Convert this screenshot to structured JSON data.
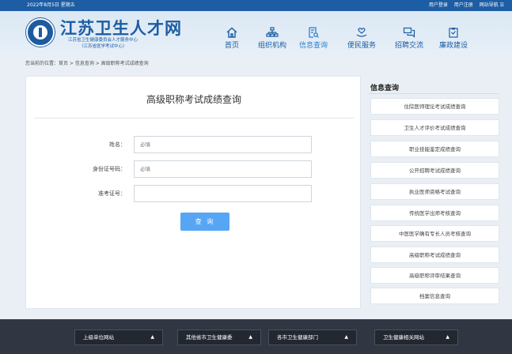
{
  "topbar": {
    "date": "2022年8月5日 星期五",
    "login": "用户登录",
    "register": "用户注册",
    "sitemap": "网站导航 ☰"
  },
  "header": {
    "title": "江苏卫生人才网",
    "subtitle1": "江苏省卫生健康委员会人才服务中心",
    "subtitle2": "（江苏省医学考试中心）",
    "brand_color": "#1c5da4",
    "nav": [
      {
        "label": "首页",
        "icon": "home-icon"
      },
      {
        "label": "组织机构",
        "icon": "org-chart-icon"
      },
      {
        "label": "信息查询",
        "icon": "search-document-icon"
      },
      {
        "label": "便民服务",
        "icon": "heart-hand-icon"
      },
      {
        "label": "招聘交流",
        "icon": "chat-icon"
      },
      {
        "label": "廉政建设",
        "icon": "clipboard-icon"
      }
    ]
  },
  "breadcrumb": "您当前的位置：首页 > 信息查询 > 高级职称考试成绩查询",
  "form": {
    "title": "高级职称考试成绩查询",
    "fields": [
      {
        "label": "姓名：",
        "placeholder": "必填"
      },
      {
        "label": "身份证号码：",
        "placeholder": "必填"
      },
      {
        "label": "准考证号：",
        "placeholder": ""
      }
    ],
    "submit_label": "查 询",
    "button_color": "#56a6f5"
  },
  "sidebar": {
    "title": "信息查询",
    "items": [
      "住院医师理论考试成绩查询",
      "卫生人才评价考试成绩查询",
      "职业技能鉴定成绩查询",
      "公开招聘考试成绩查询",
      "执业医师资格考试查询",
      "传统医学出师考核查询",
      "中医医学确有专长人员考核查询",
      "高级职称考试成绩查询",
      "高级职称评审结果查询",
      "档案信息查询"
    ]
  },
  "footer": {
    "buttons": [
      {
        "label": "上级单位网站",
        "arrow": "▲"
      },
      {
        "label": "其他省市卫生健康委",
        "arrow": "▲"
      },
      {
        "label": "各市卫生健康部门",
        "arrow": "▲"
      },
      {
        "label": "卫生健康相关网站",
        "arrow": "▲"
      }
    ]
  }
}
